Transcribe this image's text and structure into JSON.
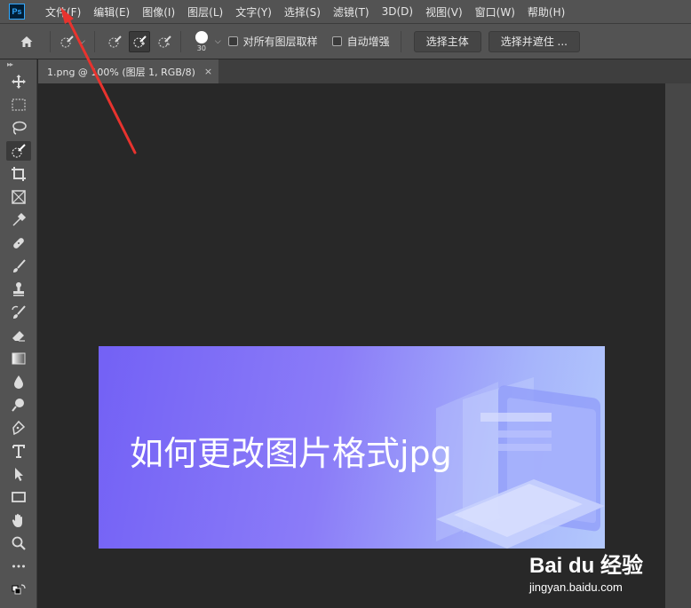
{
  "app": {
    "logo": "Ps"
  },
  "menu": {
    "items": [
      {
        "label": "文件(F)"
      },
      {
        "label": "编辑(E)"
      },
      {
        "label": "图像(I)"
      },
      {
        "label": "图层(L)"
      },
      {
        "label": "文字(Y)"
      },
      {
        "label": "选择(S)"
      },
      {
        "label": "滤镜(T)"
      },
      {
        "label": "3D(D)"
      },
      {
        "label": "视图(V)"
      },
      {
        "label": "窗口(W)"
      },
      {
        "label": "帮助(H)"
      }
    ]
  },
  "options": {
    "brush_size": "30",
    "sample_all_layers": {
      "label": "对所有图层取样",
      "checked": false
    },
    "auto_enhance": {
      "label": "自动增强",
      "checked": false
    },
    "select_subject": "选择主体",
    "select_and_mask": "选择并遮住 ..."
  },
  "document": {
    "tab_title": "1.png @ 100% (图层 1, RGB/8)",
    "close_glyph": "×",
    "image_text": "如何更改图片格式jpg"
  },
  "watermark": {
    "logo": "Bai du 经验",
    "url": "jingyan.baidu.com"
  },
  "colors": {
    "annotation_arrow": "#e8332e",
    "image_gradient_start": "#7361f5",
    "image_gradient_end": "#b3c8fc"
  },
  "tools": [
    "move-tool",
    "marquee-tool",
    "lasso-tool",
    "quick-selection-tool",
    "crop-tool",
    "frame-tool",
    "eyedropper-tool",
    "healing-brush-tool",
    "brush-tool",
    "clone-stamp-tool",
    "history-brush-tool",
    "eraser-tool",
    "gradient-tool",
    "blur-tool",
    "dodge-tool",
    "pen-tool",
    "type-tool",
    "path-selection-tool",
    "rectangle-tool",
    "hand-tool",
    "zoom-tool",
    "more-tools"
  ]
}
